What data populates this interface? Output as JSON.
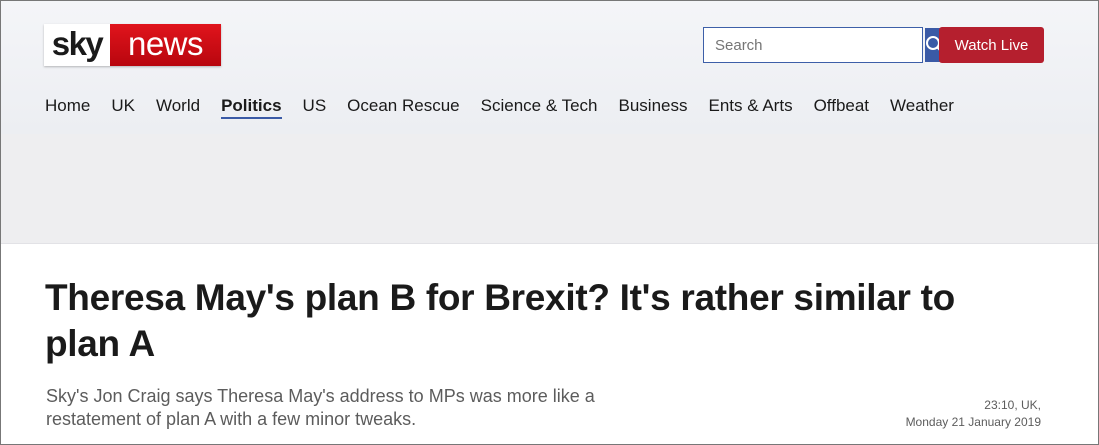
{
  "logo": {
    "sky": "sky",
    "news": "news"
  },
  "search": {
    "placeholder": "Search",
    "icon": "search-icon"
  },
  "watch_live": {
    "label": "Watch Live",
    "color": "#b51f2e"
  },
  "nav": {
    "items": [
      {
        "label": "Home"
      },
      {
        "label": "UK"
      },
      {
        "label": "World"
      },
      {
        "label": "Politics",
        "active": true
      },
      {
        "label": "US"
      },
      {
        "label": "Ocean Rescue"
      },
      {
        "label": "Science & Tech"
      },
      {
        "label": "Business"
      },
      {
        "label": "Ents & Arts"
      },
      {
        "label": "Offbeat"
      },
      {
        "label": "Weather"
      }
    ]
  },
  "article": {
    "headline_line1": "Theresa May's plan B for Brexit? It's rather similar to",
    "headline_line2": "plan A",
    "standfirst_line1": "Sky's Jon Craig says Theresa May's address to MPs was more like a",
    "standfirst_line2": "restatement of plan A with a few minor tweaks.",
    "time": "23:10, UK,",
    "date": "Monday 21 January 2019"
  },
  "colors": {
    "brand_red": "#c8101a",
    "accent_blue": "#3a5aa6"
  }
}
